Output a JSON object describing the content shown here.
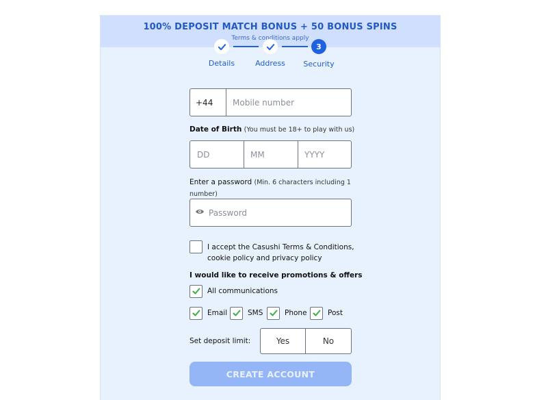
{
  "banner": {
    "title": "100% DEPOSIT MATCH BONUS + 50 BONUS SPINS",
    "subtitle": "Terms & conditions apply"
  },
  "stepper": {
    "steps": [
      {
        "label": "Details",
        "state": "done"
      },
      {
        "label": "Address",
        "state": "done"
      },
      {
        "label": "Security",
        "state": "active",
        "number": "3"
      }
    ]
  },
  "phone": {
    "prefix": "+44",
    "placeholder": "Mobile number"
  },
  "dob": {
    "label": "Date of Birth",
    "note": "(You must be 18+ to play with us)",
    "day_placeholder": "DD",
    "month_placeholder": "MM",
    "year_placeholder": "YYYY"
  },
  "password": {
    "label": "Enter a password",
    "note": "(Min. 6 characters including 1 number)",
    "placeholder": "Password"
  },
  "terms": {
    "text_line1": "I accept the Casushi Terms & Conditions,",
    "text_line2": "cookie policy and privacy policy",
    "checked": false
  },
  "promotions": {
    "heading": "I would like to receive promotions & offers",
    "all_label": "All communications",
    "email_label": "Email",
    "sms_label": "SMS",
    "phone_label": "Phone",
    "post_label": "Post"
  },
  "deposit_limit": {
    "label": "Set deposit limit:",
    "yes_label": "Yes",
    "no_label": "No"
  },
  "submit": {
    "label": "CREATE ACCOUNT"
  },
  "colors": {
    "accent": "#1f62e0",
    "check_green": "#3fae49",
    "panel_bg": "#e8f1fe",
    "banner_bg": "#cfdffd",
    "button_bg": "#94b6f6"
  }
}
